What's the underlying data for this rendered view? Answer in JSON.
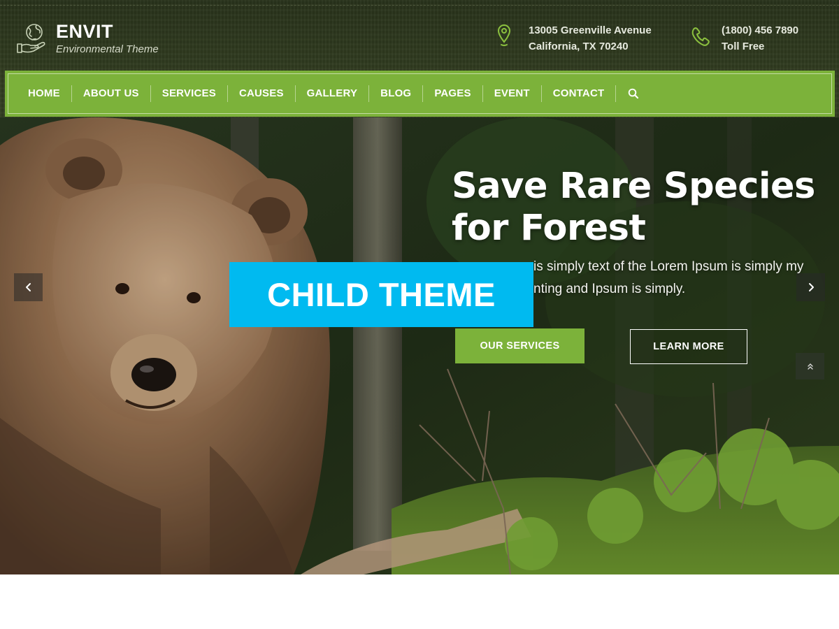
{
  "brand": {
    "title": "ENVIT",
    "subtitle": "Environmental Theme",
    "icon": "globe-hand-icon"
  },
  "contacts": {
    "address": {
      "icon": "map-pin-icon",
      "line1": "13005 Greenville Avenue",
      "line2": "California, TX 70240"
    },
    "phone": {
      "icon": "phone-icon",
      "line1": "(1800) 456 7890",
      "line2": "Toll Free"
    }
  },
  "nav": {
    "items": [
      {
        "label": "HOME"
      },
      {
        "label": "ABOUT US"
      },
      {
        "label": "SERVICES"
      },
      {
        "label": "CAUSES"
      },
      {
        "label": "GALLERY"
      },
      {
        "label": "BLOG"
      },
      {
        "label": "PAGES"
      },
      {
        "label": "EVENT"
      },
      {
        "label": "CONTACT"
      }
    ],
    "search_icon": "search-icon"
  },
  "hero": {
    "heading_line1": "Save Rare Species",
    "heading_line2": "for Forest",
    "text_line1": "is simply text of the Lorem Ipsum is simply my",
    "text_line2": "nting and Ipsum is simply.",
    "primary_button": "OUR SERVICES",
    "secondary_button": "LEARN MORE",
    "prev_icon": "chevron-left-icon",
    "next_icon": "chevron-right-icon",
    "scroll_top_icon": "double-chevron-up-icon"
  },
  "badge": {
    "label": "CHILD THEME"
  },
  "colors": {
    "accent_green": "#7cb23a",
    "header_dark": "#2f3a1f",
    "badge_blue": "#00baf0"
  }
}
